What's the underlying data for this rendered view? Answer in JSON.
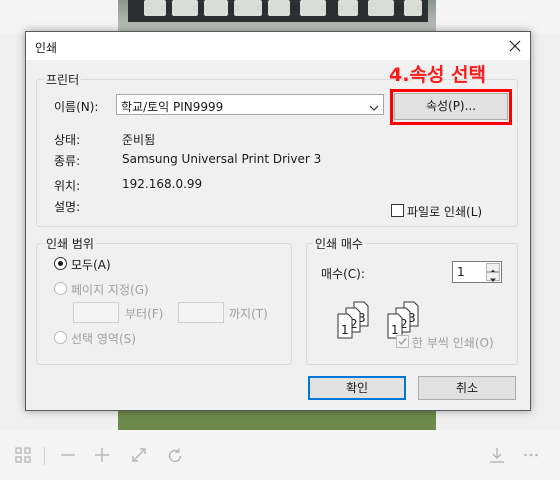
{
  "viewer": {
    "toolbar": [
      "grid-icon",
      "zoom-out-icon",
      "zoom-in-icon",
      "expand-icon",
      "rotate-icon",
      "download-icon",
      "more-icon"
    ]
  },
  "dialog": {
    "title": "인쇄",
    "printer_group": {
      "legend": "프린터",
      "name_label": "이름(N):",
      "name_value": "학교/토익 PIN9999",
      "properties_button": "속성(P)...",
      "status_label": "상태:",
      "status_value": "준비됨",
      "type_label": "종류:",
      "type_value": "Samsung Universal Print Driver 3",
      "where_label": "위치:",
      "where_value": "192.168.0.99",
      "comment_label": "설명:",
      "print_to_file": "파일로 인쇄(L)"
    },
    "range_group": {
      "legend": "인쇄 범위",
      "all": "모두(A)",
      "pages": "페이지 지정(G)",
      "from": "부터(F)",
      "to": "까지(T)",
      "selection": "선택 영역(S)"
    },
    "copies_group": {
      "legend": "인쇄 매수",
      "copies_label": "매수(C):",
      "copies_value": "1",
      "collate": "한 부씩 인쇄(O)"
    },
    "ok_button": "확인",
    "cancel_button": "취소"
  },
  "annotation": {
    "text": "4.속성 선택",
    "color": "#ff0000"
  }
}
